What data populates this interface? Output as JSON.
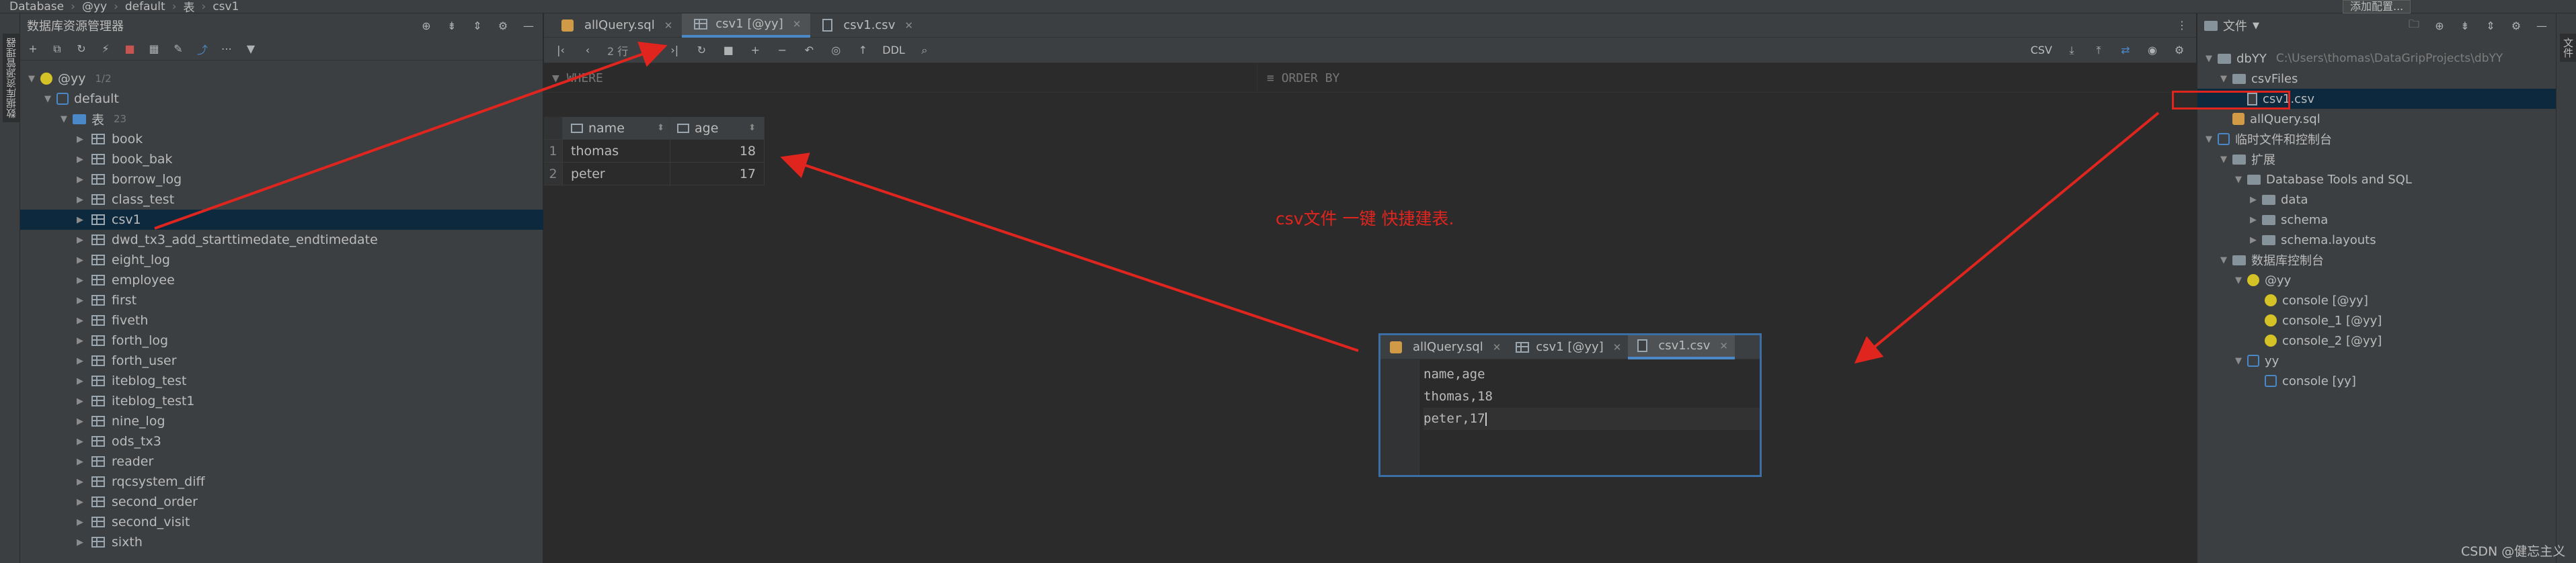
{
  "breadcrumb": [
    "Database",
    "@yy",
    "default",
    "表",
    "csv1"
  ],
  "run_config_label": "添加配置...",
  "left_strip_label": "数据库资源管理器",
  "right_strip_label": "文件",
  "db_panel": {
    "title": "数据库资源管理器",
    "tree": {
      "datasource": "@yy",
      "datasource_badge": "1/2",
      "schema": "default",
      "tables_folder": "表",
      "tables_count": "23",
      "tables": [
        "book",
        "book_bak",
        "borrow_log",
        "class_test",
        "csv1",
        "dwd_tx3_add_starttimedate_endtimedate",
        "eight_log",
        "employee",
        "first",
        "fiveth",
        "forth_log",
        "forth_user",
        "iteblog_test",
        "iteblog_test1",
        "nine_log",
        "ods_tx3",
        "reader",
        "rqcsystem_diff",
        "second_order",
        "second_visit",
        "sixth"
      ],
      "selected_table": "csv1"
    }
  },
  "editor": {
    "tabs": [
      {
        "label": "allQuery.sql",
        "active": false
      },
      {
        "label": "csv1 [@yy]",
        "active": true
      },
      {
        "label": "csv1.csv",
        "active": false
      }
    ],
    "toolbar": {
      "rows_label": "2 行",
      "ddl_label": "DDL",
      "format_label": "CSV"
    },
    "filter": {
      "where_label": "WHERE",
      "order_label": "ORDER BY"
    },
    "grid": {
      "columns": [
        "name",
        "age"
      ],
      "rows": [
        {
          "num": "1",
          "name": "thomas",
          "age": "18"
        },
        {
          "num": "2",
          "name": "peter",
          "age": "17"
        }
      ]
    }
  },
  "annotation": "csv文件 一键 快捷建表.",
  "inset": {
    "tabs": [
      {
        "label": "allQuery.sql",
        "active": false
      },
      {
        "label": "csv1 [@yy]",
        "active": false
      },
      {
        "label": "csv1.csv",
        "active": true
      }
    ],
    "lines": [
      "name,age",
      "thomas,18",
      "peter,17"
    ]
  },
  "project_panel": {
    "title": "文件",
    "root": "dbYY",
    "root_path": "C:\\Users\\thomas\\DataGripProjects\\dbYY",
    "csv_folder": "csvFiles",
    "csv_file": "csv1.csv",
    "sql_file": "allQuery.sql",
    "scratch": "临时文件和控制台",
    "extensions": "扩展",
    "db_tools": "Database Tools and SQL",
    "db_tools_children": [
      "data",
      "schema",
      "schema.layouts"
    ],
    "consoles_folder": "数据库控制台",
    "yy_at": "@yy",
    "yy_at_consoles": [
      "console [@yy]",
      "console_1 [@yy]",
      "console_2 [@yy]"
    ],
    "yy": "yy",
    "yy_consoles": [
      "console [yy]"
    ]
  },
  "watermark": "CSDN @健忘主义",
  "colors": {
    "accent": "#4a88c7",
    "annotation": "#e0251f",
    "selection": "#0d293e"
  }
}
